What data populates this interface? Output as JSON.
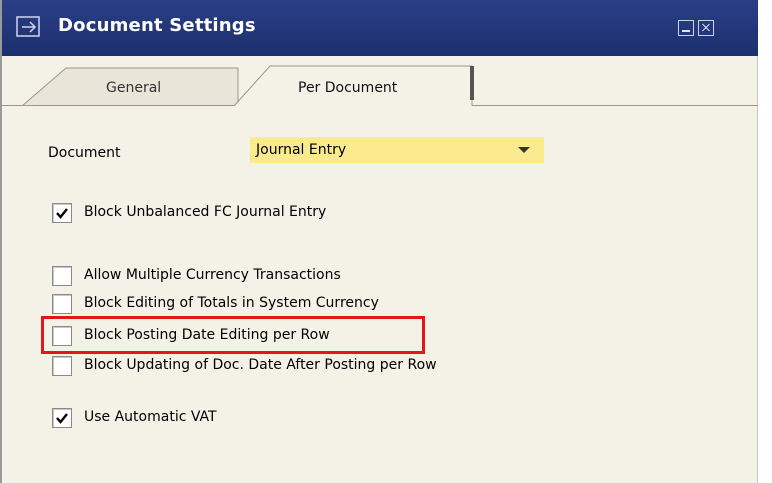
{
  "window": {
    "title": "Document Settings",
    "icon": "document-settings-icon"
  },
  "tabs": [
    {
      "label": "General",
      "active": false
    },
    {
      "label": "Per Document",
      "active": true
    }
  ],
  "document_field": {
    "label": "Document",
    "value": "Journal Entry"
  },
  "checkboxes": [
    {
      "label": "Block Unbalanced FC Journal Entry",
      "checked": true
    },
    {
      "label": "Allow Multiple Currency Transactions",
      "checked": false
    },
    {
      "label": "Block Editing of Totals in System Currency",
      "checked": false
    },
    {
      "label": "Block Posting Date Editing per Row",
      "checked": false,
      "highlighted": true
    },
    {
      "label": "Block Updating of Doc. Date After Posting per Row",
      "checked": false
    },
    {
      "label": "Use Automatic VAT",
      "checked": true
    }
  ],
  "colors": {
    "titlebar": "#1c2f6e",
    "panel": "#f4f1e7",
    "dropdown": "#fbea8e",
    "highlight": "#e6141c"
  }
}
